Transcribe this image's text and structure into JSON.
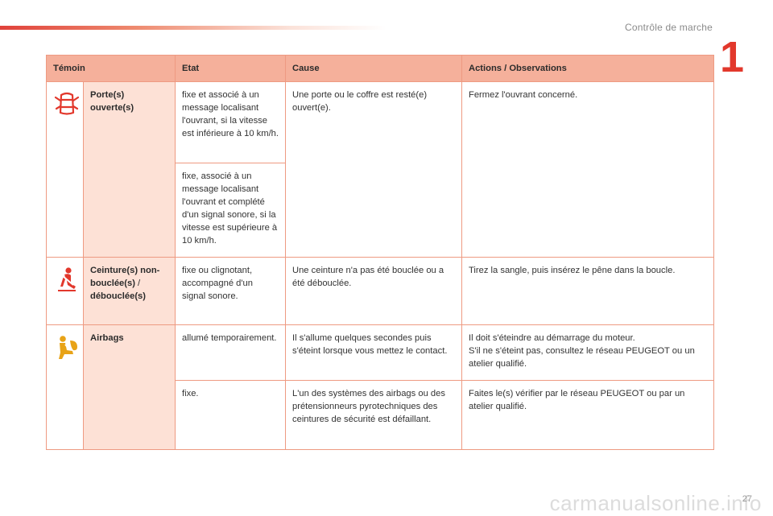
{
  "page": {
    "section_title": "Contrôle de marche",
    "chapter_number": "1",
    "page_number": "27",
    "watermark": "carmanualsonline.info"
  },
  "colors": {
    "accent_red": "#e2382c",
    "header_bg": "#f5b09b",
    "name_cell_bg": "#fde1d6",
    "border": "#ee9a82"
  },
  "table": {
    "headers": {
      "temoin": "Témoin",
      "etat": "Etat",
      "cause": "Cause",
      "actions": "Actions / Observations"
    },
    "rows": [
      {
        "icon": "door-open-icon",
        "name": "Porte(s) ouverte(s)",
        "etat": [
          "fixe et associé à un message localisant l'ouvrant, si la vitesse est inférieure à 10 km/h.",
          "fixe, associé à un message localisant l'ouvrant et complété d'un signal sonore, si la vitesse est supérieure à 10 km/h."
        ],
        "cause": "Une porte ou le coffre est resté(e) ouvert(e).",
        "actions": "Fermez l'ouvrant concerné."
      },
      {
        "icon": "seatbelt-icon",
        "name_part1": "Ceinture(s) non-bouclée(s)",
        "name_sep": " / ",
        "name_part2": "débouclée(s)",
        "etat": "fixe ou clignotant, accompagné d'un signal sonore.",
        "cause": "Une ceinture n'a pas été bouclée ou a été débouclée.",
        "actions": "Tirez la sangle, puis insérez le pêne dans la boucle."
      },
      {
        "icon": "airbag-icon",
        "name": "Airbags",
        "sub": [
          {
            "etat": "allumé temporairement.",
            "cause": "Il s'allume quelques secondes puis s'éteint lorsque vous mettez le contact.",
            "actions": [
              "Il doit s'éteindre au démarrage du moteur.",
              "S'il ne s'éteint pas, consultez le réseau PEUGEOT ou un atelier qualifié."
            ]
          },
          {
            "etat": "fixe.",
            "cause": "L'un des systèmes des airbags ou des prétensionneurs pyrotechniques des ceintures de sécurité est défaillant.",
            "actions": "Faites le(s) vérifier par le réseau PEUGEOT ou par un atelier qualifié."
          }
        ]
      }
    ]
  }
}
